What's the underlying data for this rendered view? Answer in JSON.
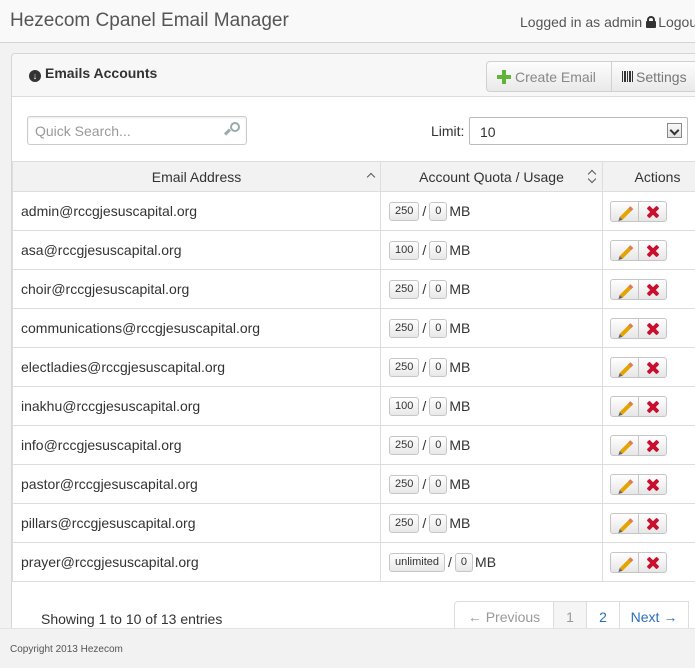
{
  "header": {
    "brand": "Hezecom Cpanel Email Manager",
    "login_status": "Logged in as admin",
    "logout_label": "Logout"
  },
  "panel": {
    "title": "Emails Accounts",
    "create_email_label": "Create Email",
    "settings_label": "Settings"
  },
  "search": {
    "placeholder": "Quick Search..."
  },
  "limit": {
    "label": "Limit:",
    "value": "10"
  },
  "table": {
    "columns": [
      "Email Address",
      "Account Quota / Usage",
      "Actions"
    ],
    "unit": "MB",
    "rows": [
      {
        "email": "admin@rccgjesuscapital.org",
        "quota": "250",
        "usage": "0"
      },
      {
        "email": "asa@rccgjesuscapital.org",
        "quota": "100",
        "usage": "0"
      },
      {
        "email": "choir@rccgjesuscapital.org",
        "quota": "250",
        "usage": "0"
      },
      {
        "email": "communications@rccgjesuscapital.org",
        "quota": "250",
        "usage": "0"
      },
      {
        "email": "electladies@rccgjesuscapital.org",
        "quota": "250",
        "usage": "0"
      },
      {
        "email": "inakhu@rccgjesuscapital.org",
        "quota": "100",
        "usage": "0"
      },
      {
        "email": "info@rccgjesuscapital.org",
        "quota": "250",
        "usage": "0"
      },
      {
        "email": "pastor@rccgjesuscapital.org",
        "quota": "250",
        "usage": "0"
      },
      {
        "email": "pillars@rccgjesuscapital.org",
        "quota": "250",
        "usage": "0"
      },
      {
        "email": "prayer@rccgjesuscapital.org",
        "quota": "unlimited",
        "usage": "0"
      }
    ]
  },
  "pagination": {
    "info": "Showing 1 to 10 of 13 entries",
    "previous": "← Previous",
    "pages": [
      "1",
      "2"
    ],
    "next": "Next →"
  },
  "footer": {
    "copyright": "Copyright 2013 Hezecom"
  },
  "colors": {
    "accent_link": "#2a6ebb",
    "plus_green": "#62b33c",
    "delete_red": "#c8102e",
    "edit_orange": "#e6a400"
  }
}
